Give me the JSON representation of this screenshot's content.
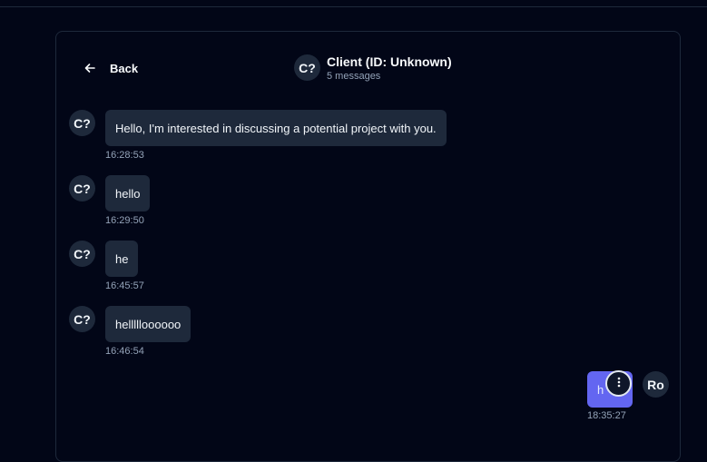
{
  "header": {
    "back_label": "Back",
    "avatar_initials": "C?",
    "title": "Client (ID: Unknown)",
    "subtitle": "5 messages"
  },
  "messages": [
    {
      "initials": "C?",
      "text": "Hello, I'm interested in discussing a potential project with you.",
      "time": "16:28:53"
    },
    {
      "initials": "C?",
      "text": "hello",
      "time": "16:29:50"
    },
    {
      "initials": "C?",
      "text": "he",
      "time": "16:45:57"
    },
    {
      "initials": "C?",
      "text": "hellllloooooo",
      "time": "16:46:54"
    }
  ],
  "own_message": {
    "text_visible": "h",
    "time": "18:35:27",
    "avatar_initials": "Ro"
  },
  "icons": {
    "back": "arrow-left-icon",
    "menu": "more-vertical-icon"
  },
  "colors": {
    "background": "#020617",
    "bubble": "#1e293b",
    "own_bubble": "#6366f1",
    "muted_text": "#94a3b8"
  }
}
